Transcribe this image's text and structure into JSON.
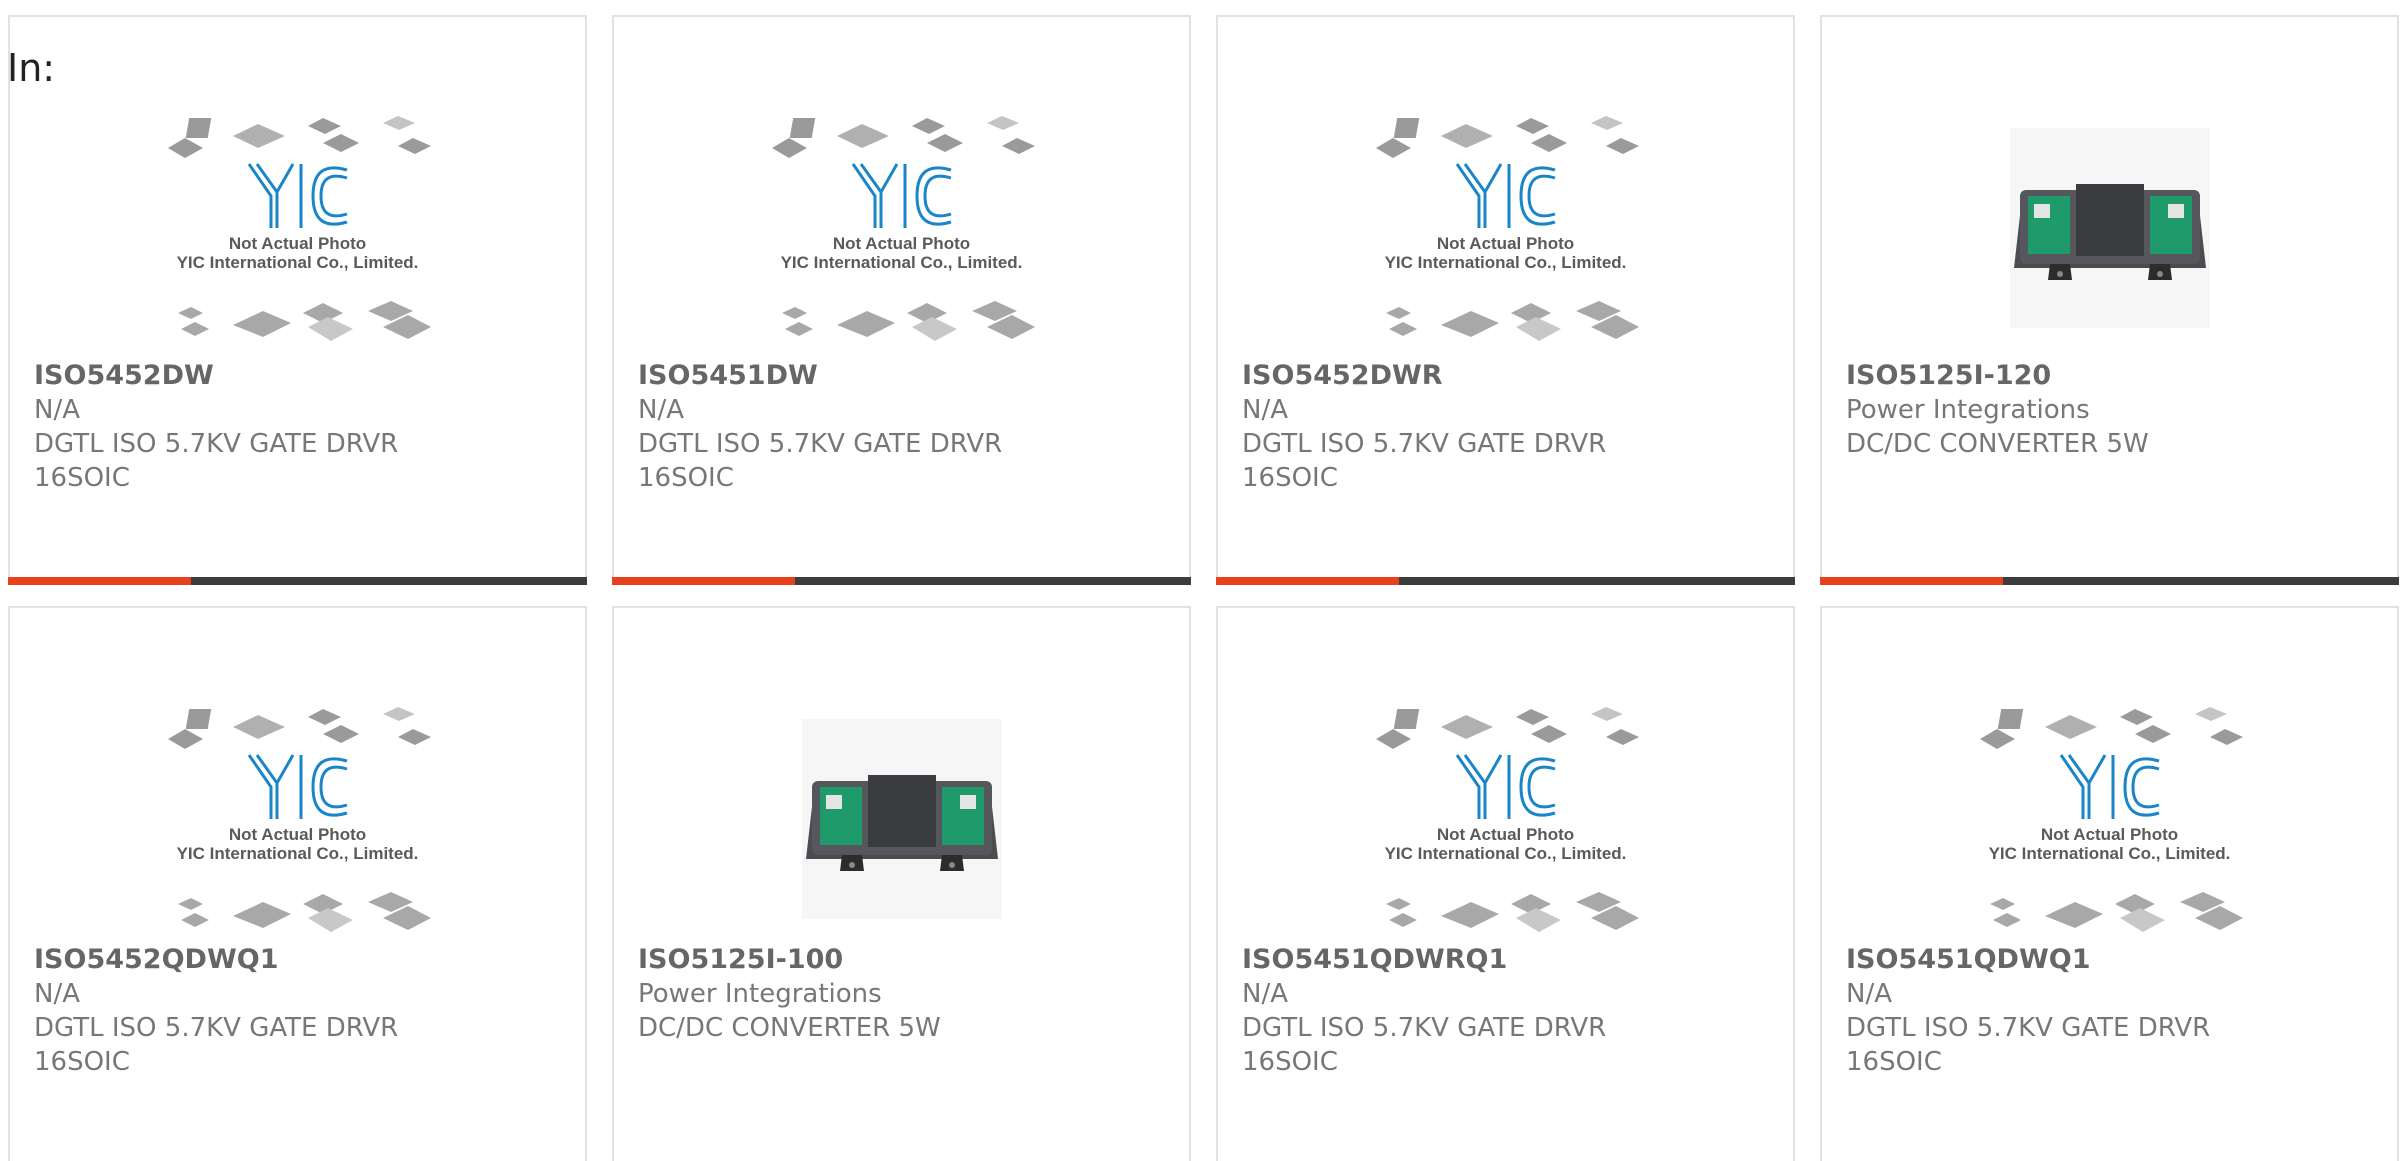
{
  "header": {
    "in_label": "In:"
  },
  "placeholder": {
    "line1": "Not Actual Photo",
    "line2": "YIC International Co., Limited."
  },
  "colors": {
    "accent": "#e8401c",
    "bar": "#3c3c3c",
    "logo_blue": "#1a86c8"
  },
  "products": [
    {
      "part": "ISO5452DW",
      "manufacturer": "N/A",
      "description": "DGTL ISO 5.7KV GATE DRVR",
      "package": "16SOIC",
      "image": "placeholder-image"
    },
    {
      "part": "ISO5451DW",
      "manufacturer": "N/A",
      "description": "DGTL ISO 5.7KV GATE DRVR",
      "package": "16SOIC",
      "image": "placeholder-image"
    },
    {
      "part": "ISO5452DWR",
      "manufacturer": "N/A",
      "description": "DGTL ISO 5.7KV GATE DRVR",
      "package": "16SOIC",
      "image": "placeholder-image"
    },
    {
      "part": "ISO5125I-120",
      "manufacturer": "Power Integrations",
      "description": "DC/DC CONVERTER 5W",
      "package": "",
      "image": "dc-dc-module-image"
    },
    {
      "part": "ISO5452QDWQ1",
      "manufacturer": "N/A",
      "description": "DGTL ISO 5.7KV GATE DRVR",
      "package": "16SOIC",
      "image": "placeholder-image"
    },
    {
      "part": "ISO5125I-100",
      "manufacturer": "Power Integrations",
      "description": "DC/DC CONVERTER 5W",
      "package": "",
      "image": "dc-dc-module-image"
    },
    {
      "part": "ISO5451QDWRQ1",
      "manufacturer": "N/A",
      "description": "DGTL ISO 5.7KV GATE DRVR",
      "package": "16SOIC",
      "image": "placeholder-image"
    },
    {
      "part": "ISO5451QDWQ1",
      "manufacturer": "N/A",
      "description": "DGTL ISO 5.7KV GATE DRVR",
      "package": "16SOIC",
      "image": "placeholder-image"
    }
  ]
}
